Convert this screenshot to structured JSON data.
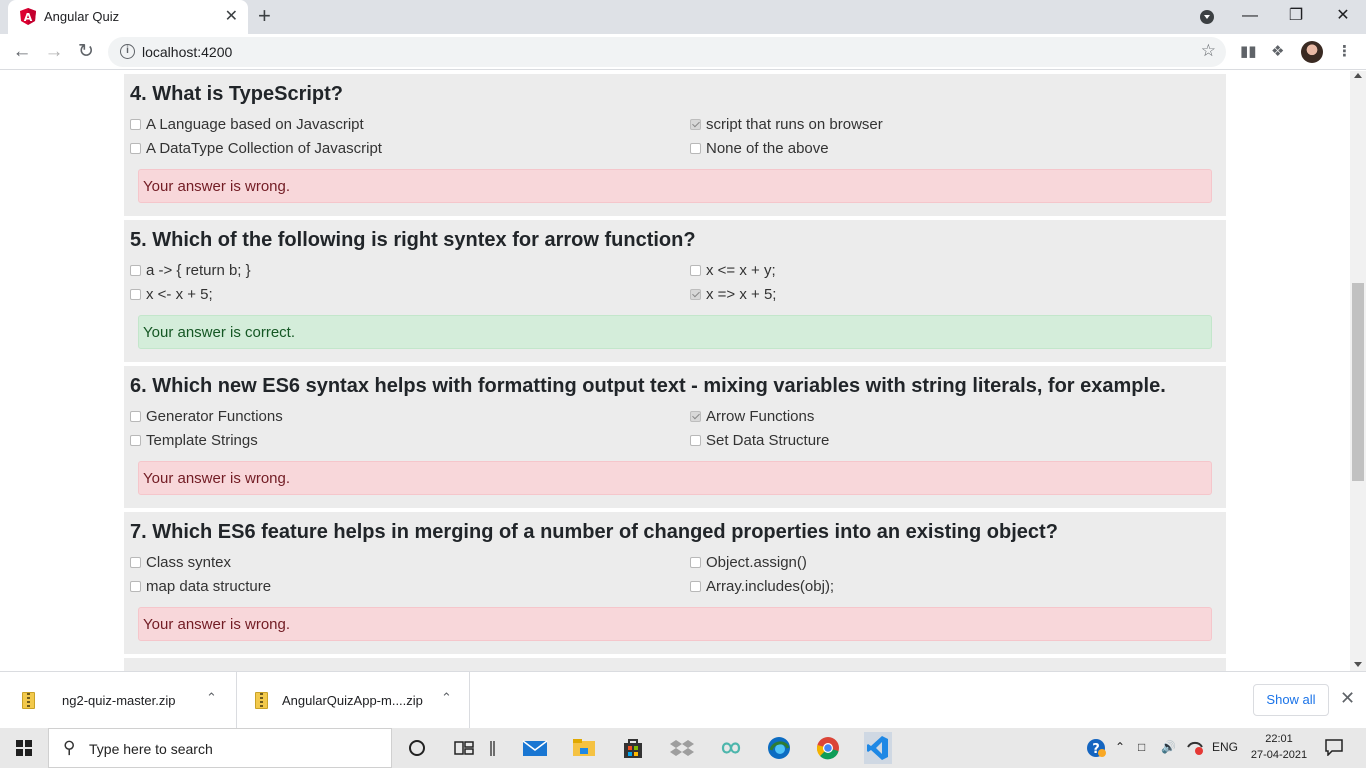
{
  "browser": {
    "tab_title": "Angular Quiz",
    "tab_close": "✕",
    "new_tab": "+",
    "url": "localhost:4200",
    "window_controls": {
      "minimize": "—",
      "restore": "❐",
      "close": "✕"
    }
  },
  "questions": [
    {
      "title": "4. What is TypeScript?",
      "options": [
        {
          "label": "A Language based on Javascript",
          "checked": false
        },
        {
          "label": "script that runs on browser",
          "checked": true
        },
        {
          "label": "A DataType Collection of Javascript",
          "checked": false
        },
        {
          "label": "None of the above",
          "checked": false
        }
      ],
      "result": "Your answer is wrong.",
      "status": "wrong"
    },
    {
      "title": "5. Which of the following is right syntex for arrow function?",
      "options": [
        {
          "label": "a -> { return b; }",
          "checked": false
        },
        {
          "label": "x <= x + y;",
          "checked": false
        },
        {
          "label": "x <- x + 5;",
          "checked": false
        },
        {
          "label": "x => x + 5;",
          "checked": true
        }
      ],
      "result": "Your answer is correct.",
      "status": "correct"
    },
    {
      "title": "6. Which new ES6 syntax helps with formatting output text - mixing variables with string literals, for example.",
      "options": [
        {
          "label": "Generator Functions",
          "checked": false
        },
        {
          "label": "Arrow Functions",
          "checked": true
        },
        {
          "label": "Template Strings",
          "checked": false
        },
        {
          "label": "Set Data Structure",
          "checked": false
        }
      ],
      "result": "Your answer is wrong.",
      "status": "wrong"
    },
    {
      "title": "7. Which ES6 feature helps in merging of a number of changed properties into an existing object?",
      "options": [
        {
          "label": "Class syntex",
          "checked": false
        },
        {
          "label": "Object.assign()",
          "checked": false
        },
        {
          "label": "map data structure",
          "checked": false
        },
        {
          "label": "Array.includes(obj);",
          "checked": false
        }
      ],
      "result": "Your answer is wrong.",
      "status": "wrong"
    }
  ],
  "downloads": {
    "items": [
      {
        "name": "ng2-quiz-master.zip"
      },
      {
        "name": "AngularQuizApp-m....zip"
      }
    ],
    "show_all": "Show all"
  },
  "taskbar": {
    "search_placeholder": "Type here to search",
    "language": "ENG",
    "time": "22:01",
    "date": "27-04-2021"
  }
}
